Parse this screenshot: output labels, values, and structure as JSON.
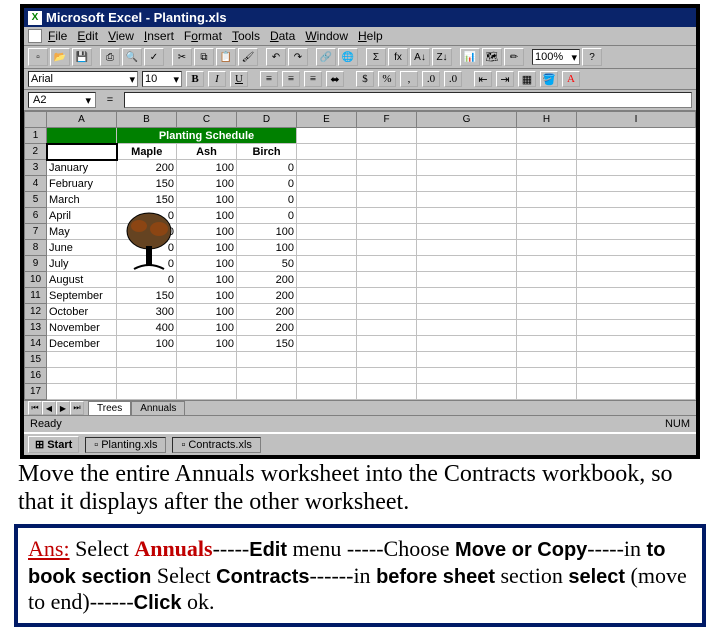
{
  "title": "Microsoft Excel - Planting.xls",
  "menu": [
    "File",
    "Edit",
    "View",
    "Insert",
    "Format",
    "Tools",
    "Data",
    "Window",
    "Help"
  ],
  "zoom": "100%",
  "font": "Arial",
  "fontsize": "10",
  "namebox": "A2",
  "columns": [
    "A",
    "B",
    "C",
    "D",
    "E",
    "F",
    "G",
    "H",
    "I"
  ],
  "rows": [
    "1",
    "2",
    "3",
    "4",
    "5",
    "6",
    "7",
    "8",
    "9",
    "10",
    "11",
    "12",
    "13",
    "14",
    "15",
    "16",
    "17"
  ],
  "header_title": "Planting Schedule",
  "subheaders": [
    "",
    "Maple",
    "Ash",
    "Birch"
  ],
  "data": [
    [
      "January",
      "200",
      "100",
      "0"
    ],
    [
      "February",
      "150",
      "100",
      "0"
    ],
    [
      "March",
      "150",
      "100",
      "0"
    ],
    [
      "April",
      "0",
      "100",
      "0"
    ],
    [
      "May",
      "0",
      "100",
      "100"
    ],
    [
      "June",
      "0",
      "100",
      "100"
    ],
    [
      "July",
      "0",
      "100",
      "50"
    ],
    [
      "August",
      "0",
      "100",
      "200"
    ],
    [
      "September",
      "150",
      "100",
      "200"
    ],
    [
      "October",
      "300",
      "100",
      "200"
    ],
    [
      "November",
      "400",
      "100",
      "200"
    ],
    [
      "December",
      "100",
      "100",
      "150"
    ]
  ],
  "tabs": {
    "active": "Trees",
    "inactive": "Annuals"
  },
  "status_left": "Ready",
  "status_right": "NUM",
  "taskbar": {
    "start": "Start",
    "item1": "Planting.xls",
    "item2": "Contracts.xls"
  },
  "question": "Move the entire Annuals worksheet into the Contracts workbook, so that it displays after the other worksheet.",
  "answer": {
    "label": "Ans:",
    "p1a": " Select ",
    "annuals": "Annuals",
    "p1b": "-----",
    "edit": "Edit",
    "p2": " menu -----Choose ",
    "move": "Move or Copy",
    "p3": "-----in ",
    "book": "to book section",
    "p4": " Select  ",
    "contracts": "Contracts",
    "p5": "------in ",
    "before": "before sheet",
    "p6": " section ",
    "select": "select",
    "p7": " (move to end)------",
    "click": "Click",
    "p8": " ok."
  }
}
